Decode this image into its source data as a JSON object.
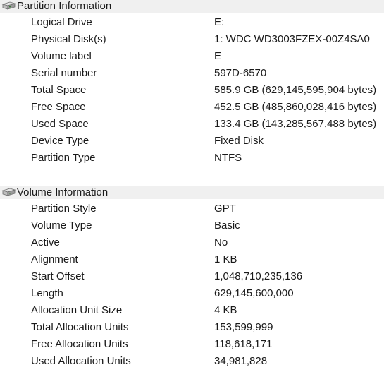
{
  "partition": {
    "title": "Partition Information",
    "icon": "drive-icon",
    "rows": [
      {
        "label": "Logical Drive",
        "value": "E:"
      },
      {
        "label": "Physical Disk(s)",
        "value": "1: WDC WD3003FZEX-00Z4SA0"
      },
      {
        "label": "Volume label",
        "value": "E"
      },
      {
        "label": "Serial number",
        "value": "597D-6570"
      },
      {
        "label": "Total Space",
        "value": "585.9 GB (629,145,595,904 bytes)"
      },
      {
        "label": "Free Space",
        "value": "452.5 GB (485,860,028,416 bytes)"
      },
      {
        "label": "Used Space",
        "value": "133.4 GB (143,285,567,488 bytes)"
      },
      {
        "label": "Device Type",
        "value": "Fixed Disk"
      },
      {
        "label": "Partition Type",
        "value": "NTFS"
      }
    ]
  },
  "volume": {
    "title": "Volume Information",
    "icon": "drive-icon",
    "rows": [
      {
        "label": "Partition Style",
        "value": "GPT"
      },
      {
        "label": "Volume Type",
        "value": "Basic"
      },
      {
        "label": "Active",
        "value": "No"
      },
      {
        "label": "Alignment",
        "value": "1 KB"
      },
      {
        "label": "Start Offset",
        "value": "1,048,710,235,136"
      },
      {
        "label": "Length",
        "value": "629,145,600,000"
      },
      {
        "label": "Allocation Unit Size",
        "value": "4 KB"
      },
      {
        "label": "Total Allocation Units",
        "value": "153,599,999"
      },
      {
        "label": "Free Allocation Units",
        "value": "118,618,171"
      },
      {
        "label": "Used Allocation Units",
        "value": "34,981,828"
      }
    ]
  }
}
